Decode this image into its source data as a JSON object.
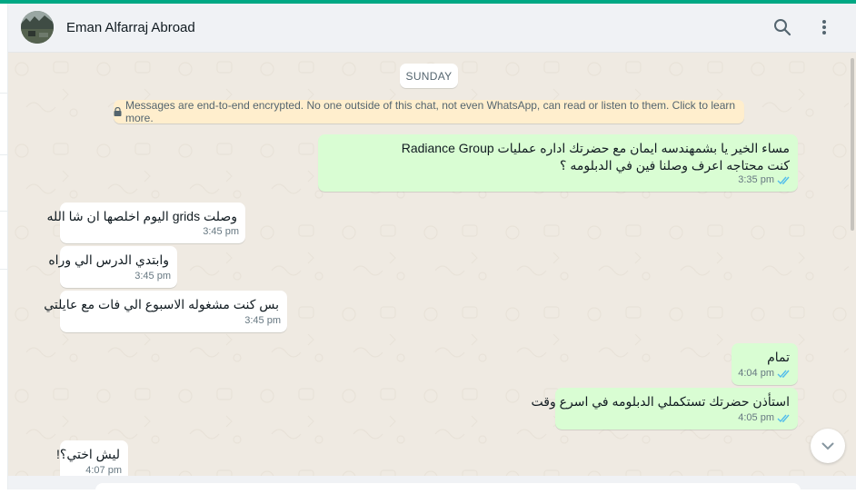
{
  "header": {
    "contact_name": "Eman Alfarraj Abroad",
    "icons": [
      "search-icon",
      "menu-dots-icon"
    ]
  },
  "chat": {
    "day_label": "SUNDAY",
    "encryption_notice": "Messages are end-to-end encrypted. No one outside of this chat, not even WhatsApp, can read or listen to them. Click to learn more.",
    "messages": [
      {
        "direction": "out",
        "lines": [
          "مساء الخير يا بشمهندسه ايمان مع حضرتك اداره عمليات Radiance Group",
          "كنت محتاجه اعرف وصلنا فين في الدبلومه  ؟"
        ],
        "time": "3:35 pm",
        "status": "read"
      },
      {
        "direction": "in",
        "lines": [
          "وصلت grids اليوم اخلصها ان شا الله"
        ],
        "time": "3:45 pm"
      },
      {
        "direction": "in",
        "lines": [
          "وابتدي الدرس الي وراه"
        ],
        "time": "3:45 pm"
      },
      {
        "direction": "in",
        "lines": [
          "بس كنت مشغوله الاسبوع الي فات مع عايلتي"
        ],
        "time": "3:45 pm"
      },
      {
        "direction": "out",
        "lines": [
          "تمام"
        ],
        "time": "4:04 pm",
        "status": "read"
      },
      {
        "direction": "out",
        "lines": [
          "استأذن حضرتك تستكملي الدبلومه في اسرع وقت"
        ],
        "time": "4:05 pm",
        "status": "read"
      },
      {
        "direction": "in",
        "lines": [
          "ليش اختي؟!"
        ],
        "time": "4:07 pm"
      }
    ]
  },
  "colors": {
    "accent": "#00a884",
    "outgoing_bubble": "#d9fdd3",
    "incoming_bubble": "#ffffff",
    "chat_background": "#efeae2",
    "read_ticks": "#53bdeb",
    "notice_background": "#ffeecd"
  }
}
